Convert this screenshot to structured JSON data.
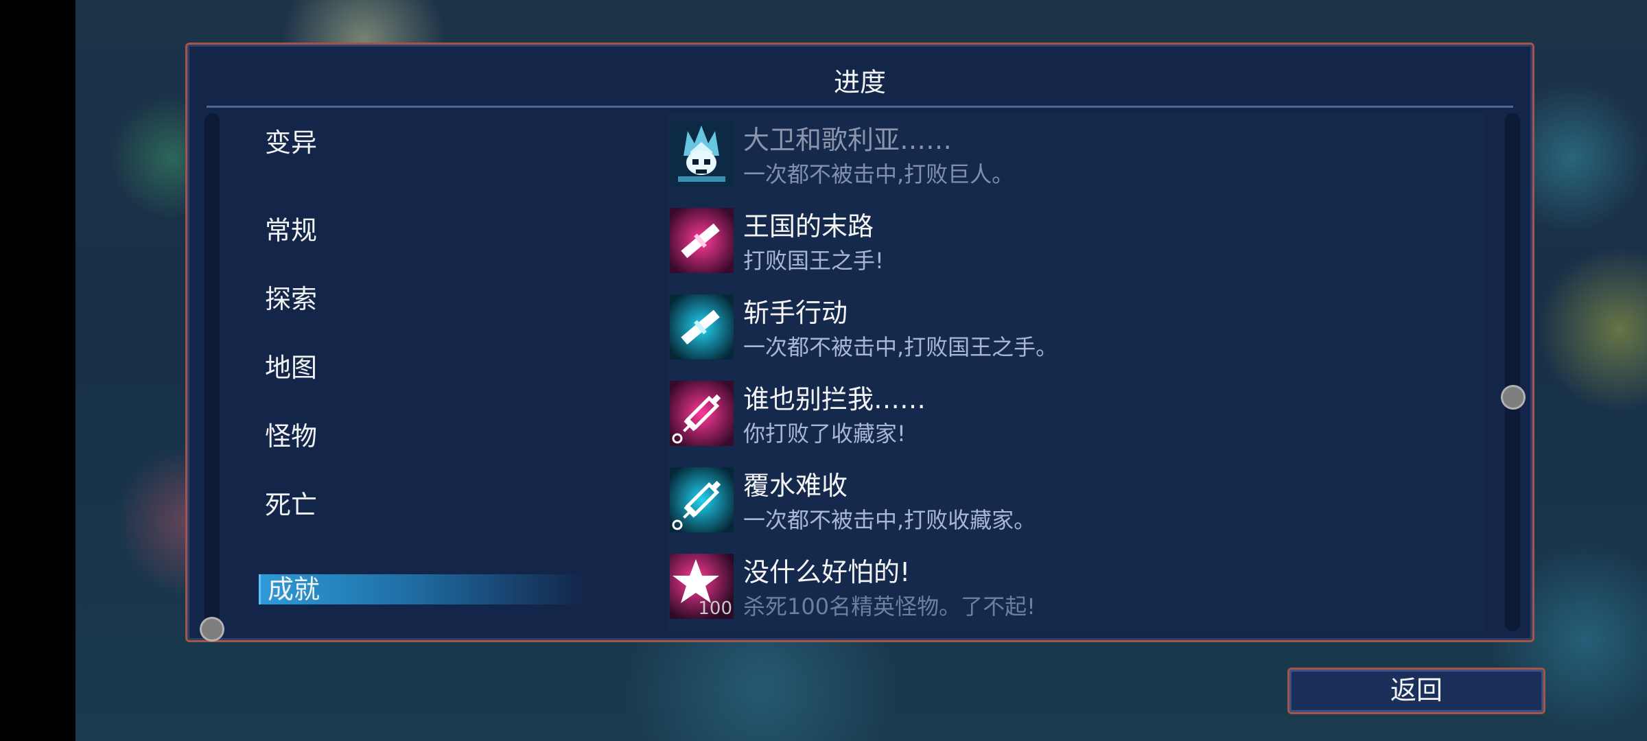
{
  "window": {
    "title": "进度"
  },
  "sidebar": {
    "items": [
      {
        "label": "变异"
      },
      {
        "label": "常规"
      },
      {
        "label": "探索"
      },
      {
        "label": "地图"
      },
      {
        "label": "怪物"
      },
      {
        "label": "死亡"
      },
      {
        "label": "成就",
        "selected": true
      }
    ]
  },
  "achievements": [
    {
      "title": "大卫和歌利亚……",
      "description": "一次都不被击中,打败巨人。",
      "icon": "skull-crown-icon"
    },
    {
      "title": "王国的末路",
      "description": "打败国王之手!",
      "icon": "pink-sword-icon"
    },
    {
      "title": "斩手行动",
      "description": "一次都不被击中,打败国王之手。",
      "icon": "cyan-sword-icon"
    },
    {
      "title": "谁也别拦我……",
      "description": "你打败了收藏家!",
      "icon": "pink-syringe-icon"
    },
    {
      "title": "覆水难收",
      "description": "一次都不被击中,打败收藏家。",
      "icon": "cyan-syringe-icon"
    },
    {
      "title": "没什么好怕的!",
      "description": "杀死100名精英怪物。了不起!",
      "icon": "star-icon",
      "badge": "100"
    }
  ],
  "buttons": {
    "back": "返回"
  },
  "colors": {
    "panel_border": "#a55545",
    "panel_bg": "#13264a",
    "selected_tab": "#2e9ad8",
    "pink_icon": "#ff2f8e",
    "cyan_icon": "#22d6f4"
  }
}
